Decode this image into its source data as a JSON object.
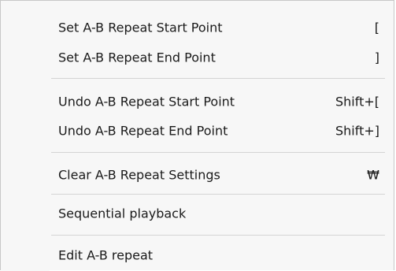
{
  "menu": {
    "items": [
      {
        "label": "Set A-B Repeat Start Point",
        "shortcut": "["
      },
      {
        "label": "Set A-B Repeat End Point",
        "shortcut": "]"
      },
      {
        "label": "Undo A-B Repeat Start Point",
        "shortcut": "Shift+["
      },
      {
        "label": "Undo A-B Repeat End Point",
        "shortcut": "Shift+]"
      },
      {
        "label": "Clear A-B Repeat Settings",
        "shortcut": "₩"
      },
      {
        "label": "Sequential playback",
        "shortcut": ""
      },
      {
        "label": "Edit A-B repeat",
        "shortcut": ""
      }
    ]
  }
}
